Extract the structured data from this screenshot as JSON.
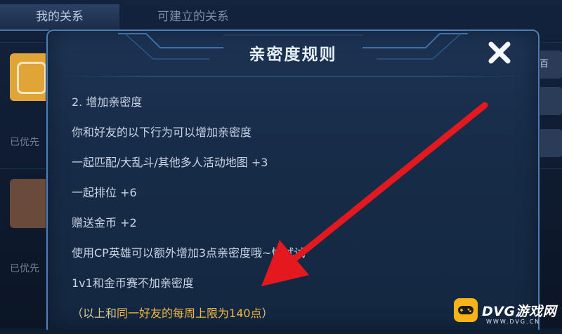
{
  "tabs": {
    "my_relations": "我的关系",
    "other": "可建立的关系"
  },
  "background": {
    "row1_label": "已优先",
    "row2_label": "已优先",
    "right_fragment": "百"
  },
  "dialog": {
    "title": "亲密度规则",
    "close_icon": "close-x-icon",
    "rules": [
      "2. 增加亲密度",
      "你和好友的以下行为可以增加亲密度",
      "一起匹配/大乱斗/其他多人活动地图 +3",
      "一起排位 +6",
      "赠送金币 +2",
      "使用CP英雄可以额外增加3点亲密度哦~快试试",
      "1v1和金币赛不加亲密度"
    ],
    "note": {
      "prefix": "（以上和",
      "highlight": "同一好友的每周上限为140点",
      "suffix": "）"
    }
  },
  "watermark": {
    "brand": "DVG游戏网",
    "url": "WWW.DVG.CN"
  },
  "colors": {
    "dialog_border": "#4f7eb8",
    "text": "#c9d4e4",
    "highlight": "#f2b640",
    "arrow": "#e3191f"
  }
}
